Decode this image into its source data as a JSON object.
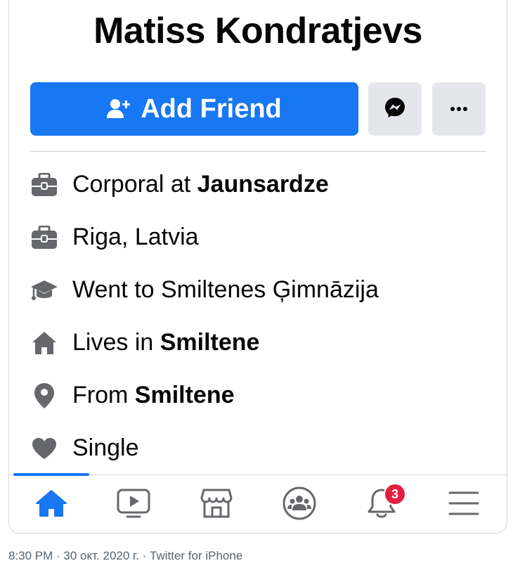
{
  "profile": {
    "name": "Matiss Kondratjevs"
  },
  "actions": {
    "add_friend_label": "Add Friend"
  },
  "intro": {
    "items": [
      {
        "icon": "briefcase-icon",
        "prefix": "Corporal at ",
        "bold": "Jaunsardze"
      },
      {
        "icon": "briefcase-icon",
        "prefix": "Riga, Latvia",
        "bold": ""
      },
      {
        "icon": "graduation-cap-icon",
        "prefix": "Went to Smiltenes Ģimnāzija",
        "bold": ""
      },
      {
        "icon": "home-icon",
        "prefix": "Lives in ",
        "bold": "Smiltene"
      },
      {
        "icon": "location-pin-icon",
        "prefix": "From ",
        "bold": "Smiltene"
      },
      {
        "icon": "heart-icon",
        "prefix": "Single",
        "bold": ""
      }
    ]
  },
  "tabbar": {
    "tabs": [
      {
        "icon": "home-tab-icon",
        "active": true
      },
      {
        "icon": "watch-tab-icon",
        "active": false
      },
      {
        "icon": "marketplace-tab-icon",
        "active": false
      },
      {
        "icon": "groups-tab-icon",
        "active": false
      },
      {
        "icon": "notifications-tab-icon",
        "active": false
      },
      {
        "icon": "menu-tab-icon",
        "active": false
      }
    ],
    "notification_count": "3"
  },
  "footer": {
    "time": "8:30 PM",
    "separator": " · ",
    "date": "30 окт. 2020 г.",
    "client": "Twitter for iPhone"
  },
  "colors": {
    "accent": "#1877f2",
    "icon_gray": "#65676b",
    "badge": "#e41e3f"
  }
}
